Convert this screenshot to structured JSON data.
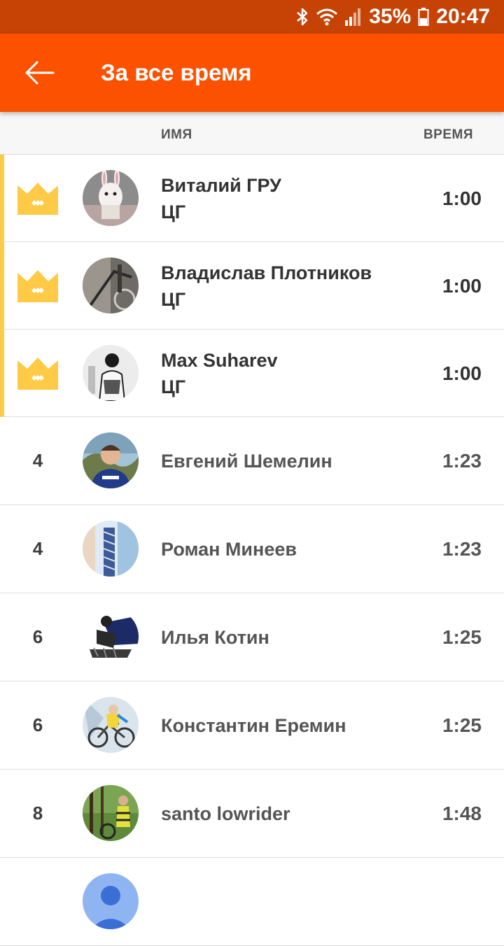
{
  "status": {
    "battery": "35%",
    "time": "20:47"
  },
  "appbar": {
    "title": "За все время"
  },
  "columns": {
    "name": "ИМЯ",
    "time": "ВРЕМЯ"
  },
  "colors": {
    "brand": "#fc5200",
    "status_bar": "#c64205",
    "crown": "#ffca45"
  },
  "rows": [
    {
      "rank": "",
      "icon": "crown-icon",
      "name": "Виталий ГРУ",
      "club": "ЦГ",
      "time": "1:00"
    },
    {
      "rank": "",
      "icon": "crown-icon",
      "name": "Владислав Плотников",
      "club": "ЦГ",
      "time": "1:00"
    },
    {
      "rank": "",
      "icon": "crown-icon",
      "name": "Max Suharev",
      "club": "ЦГ",
      "time": "1:00"
    },
    {
      "rank": "4",
      "name": "Евгений Шемелин",
      "time": "1:23"
    },
    {
      "rank": "4",
      "name": "Роман Минеев",
      "time": "1:23"
    },
    {
      "rank": "6",
      "name": "Илья Котин",
      "time": "1:25"
    },
    {
      "rank": "6",
      "name": "Константин Еремин",
      "time": "1:25"
    },
    {
      "rank": "8",
      "name": "santo lowrider",
      "time": "1:48"
    }
  ]
}
